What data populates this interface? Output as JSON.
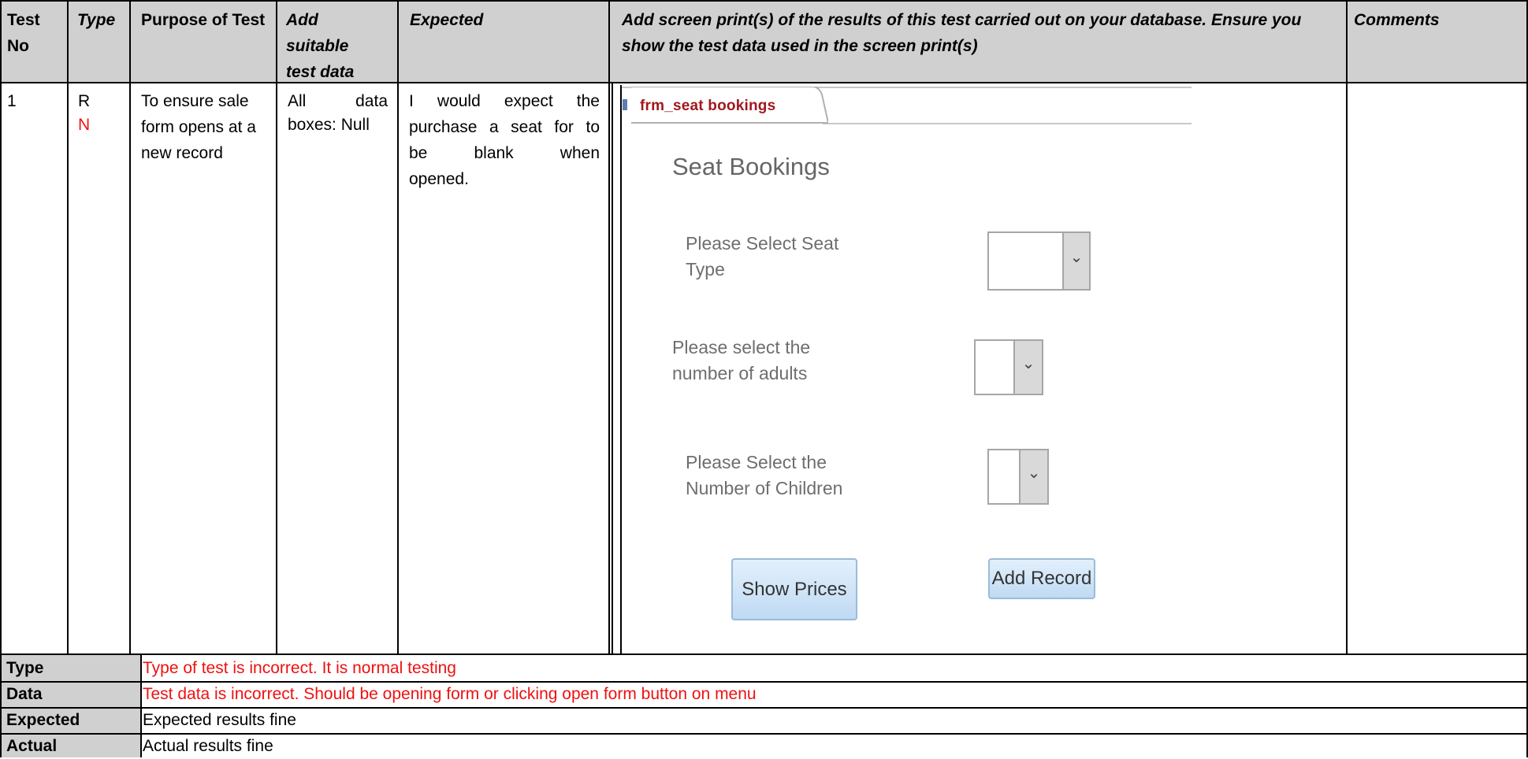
{
  "headers": {
    "test_no": "Test No",
    "type": "Type",
    "purpose": "Purpose of Test",
    "test_data": "Add suitable test data",
    "expected": "Expected",
    "screen_print": "Add screen print(s) of the results of this test carried out on your database. Ensure you show the test data used in the screen print(s)",
    "comments": "Comments"
  },
  "row": {
    "test_no": "1",
    "type_r": "R",
    "type_n": "N",
    "purpose": "To ensure sale form opens at a new record",
    "test_data_line1": "All data",
    "test_data_line2": "boxes: Null",
    "expected_line1": "I would expect the",
    "expected_line2": "purchase a seat for to",
    "expected_line3": "be blank when",
    "expected_line4": "opened.",
    "comments": ""
  },
  "form": {
    "tab_label": "frm_seat bookings",
    "title": "Seat Bookings",
    "seat_type_label": "Please Select Seat Type",
    "adults_label": "Please select the number of adults",
    "children_label": "Please Select the Number of Children",
    "show_prices_button": "Show Prices",
    "add_record_button": "Add Record",
    "dropdown_glyph": "⌄"
  },
  "feedback": [
    {
      "label": "Type",
      "value": "Type of test is incorrect. It is normal testing",
      "color": "#ee1111"
    },
    {
      "label": "Data",
      "value": "Test data is incorrect. Should be opening form or clicking open form button on menu",
      "color": "#ee1111"
    },
    {
      "label": "Expected",
      "value": "Expected results fine",
      "color": "#000000"
    },
    {
      "label": "Actual",
      "value": "Actual results fine",
      "color": "#000000"
    }
  ]
}
